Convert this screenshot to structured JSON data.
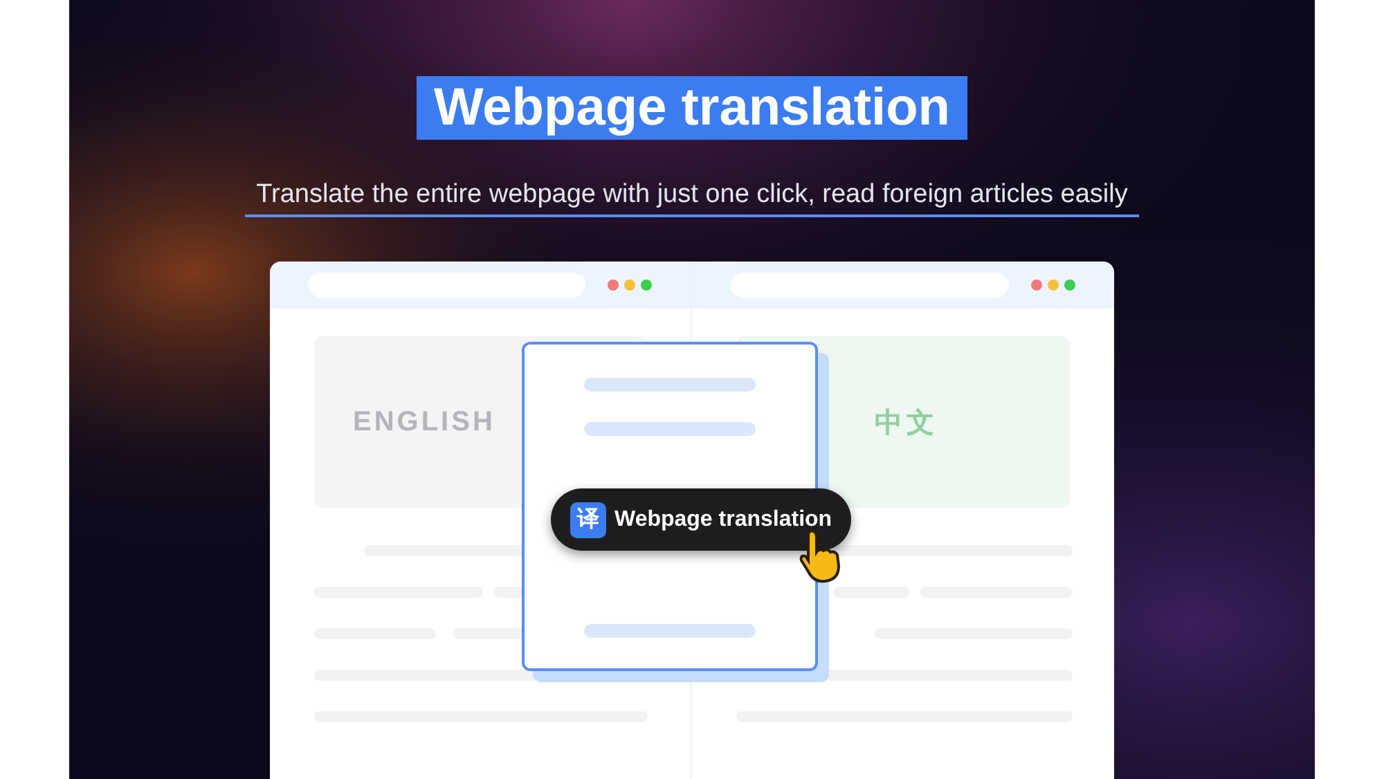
{
  "headline": "Webpage translation",
  "subtitle": "Translate the entire webpage with just one click, read foreign articles easily",
  "panes": [
    {
      "kind": "source",
      "language_label": "ENGLISH"
    },
    {
      "kind": "target",
      "language_label": "中文"
    }
  ],
  "popup": {
    "icon_char": "译",
    "label": "Webpage translation"
  }
}
